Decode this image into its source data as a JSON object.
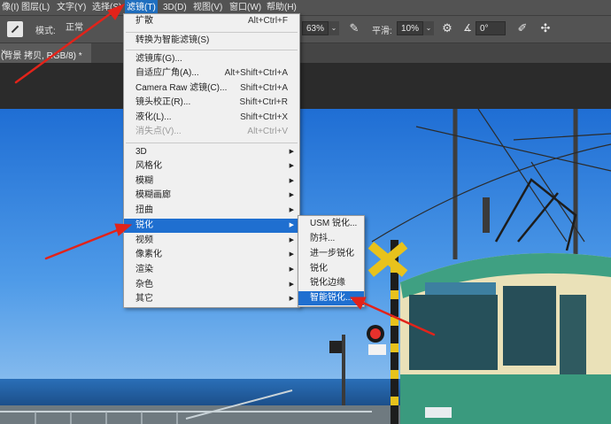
{
  "menubar": {
    "items": [
      "像(I)",
      "图层(L)",
      "文字(Y)",
      "选择(S)",
      "滤镜(T)",
      "3D(D)",
      "视图(V)",
      "窗口(W)",
      "帮助(H)"
    ]
  },
  "options": {
    "mode_label": "模式:",
    "mode_value": "正常",
    "strength_value": "63%",
    "smooth_label": "平滑:",
    "smooth_value": "10%",
    "angle_value": "0°"
  },
  "document": {
    "tab_title": "(背景 拷贝, RGB/8) *",
    "close_glyph": "×"
  },
  "filter_menu": {
    "items": [
      {
        "label": "扩散",
        "shortcut": "Alt+Ctrl+F"
      },
      {
        "label": "转换为智能滤镜(S)"
      },
      {
        "label": "滤镜库(G)..."
      },
      {
        "label": "自适应广角(A)...",
        "shortcut": "Alt+Shift+Ctrl+A"
      },
      {
        "label": "Camera Raw 滤镜(C)...",
        "shortcut": "Shift+Ctrl+A"
      },
      {
        "label": "镜头校正(R)...",
        "shortcut": "Shift+Ctrl+R"
      },
      {
        "label": "液化(L)...",
        "shortcut": "Shift+Ctrl+X"
      },
      {
        "label": "消失点(V)...",
        "shortcut": "Alt+Ctrl+V"
      },
      {
        "label": "3D"
      },
      {
        "label": "风格化"
      },
      {
        "label": "模糊"
      },
      {
        "label": "模糊画廊"
      },
      {
        "label": "扭曲"
      },
      {
        "label": "锐化"
      },
      {
        "label": "视频"
      },
      {
        "label": "像素化"
      },
      {
        "label": "渲染"
      },
      {
        "label": "杂色"
      },
      {
        "label": "其它"
      }
    ]
  },
  "sharpen_submenu": {
    "items": [
      "USM 锐化...",
      "防抖...",
      "进一步锐化",
      "锐化",
      "锐化边缘",
      "智能锐化..."
    ]
  },
  "colors": {
    "accent": "#1f6fd0",
    "menu_bg": "#f0f0f0",
    "ui_dark": "#535353"
  },
  "icons": [
    "brush-tool-icon",
    "airbrush-icon",
    "gear-icon",
    "angle-icon",
    "pressure-icon",
    "symmetry-icon"
  ]
}
